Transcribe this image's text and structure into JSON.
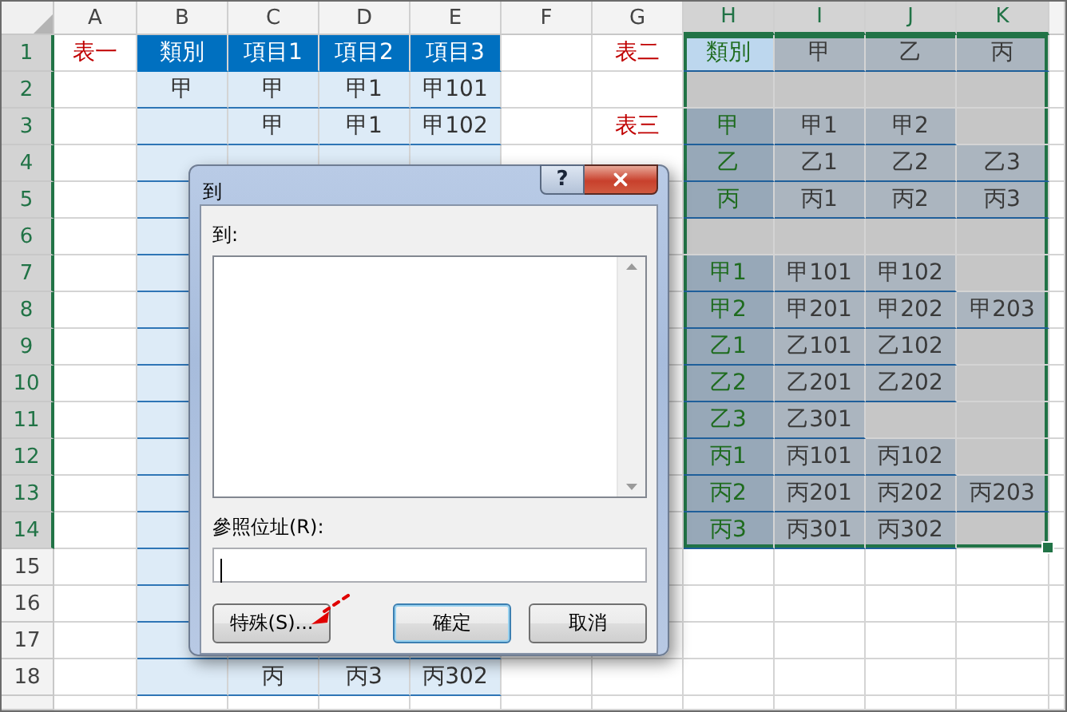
{
  "sheet": {
    "columns": [
      {
        "label": "A",
        "selected": false
      },
      {
        "label": "B",
        "selected": false
      },
      {
        "label": "C",
        "selected": false
      },
      {
        "label": "D",
        "selected": false
      },
      {
        "label": "E",
        "selected": false
      },
      {
        "label": "F",
        "selected": false
      },
      {
        "label": "G",
        "selected": false
      },
      {
        "label": "H",
        "selected": true
      },
      {
        "label": "I",
        "selected": true
      },
      {
        "label": "J",
        "selected": true
      },
      {
        "label": "K",
        "selected": true
      }
    ],
    "rows": [
      {
        "label": "1",
        "selected": true,
        "cells": [
          "表一",
          "類別",
          "項目1",
          "項目2",
          "項目3",
          null,
          "表二",
          "類別",
          "甲",
          "乙",
          "丙"
        ]
      },
      {
        "label": "2",
        "selected": true,
        "cells": [
          null,
          "甲",
          "甲",
          "甲1",
          "甲101",
          null,
          null,
          null,
          null,
          null,
          null
        ]
      },
      {
        "label": "3",
        "selected": true,
        "cells": [
          null,
          null,
          "甲",
          "甲1",
          "甲102",
          null,
          "表三",
          "甲",
          "甲1",
          "甲2",
          null
        ]
      },
      {
        "label": "4",
        "selected": true,
        "cells": [
          null,
          null,
          null,
          null,
          null,
          null,
          null,
          "乙",
          "乙1",
          "乙2",
          "乙3"
        ]
      },
      {
        "label": "5",
        "selected": true,
        "cells": [
          null,
          null,
          null,
          null,
          null,
          null,
          null,
          "丙",
          "丙1",
          "丙2",
          "丙3"
        ]
      },
      {
        "label": "6",
        "selected": true,
        "cells": [
          null,
          null,
          null,
          null,
          null,
          null,
          null,
          null,
          null,
          null,
          null
        ]
      },
      {
        "label": "7",
        "selected": true,
        "cells": [
          null,
          null,
          null,
          null,
          null,
          null,
          null,
          "甲1",
          "甲101",
          "甲102",
          null
        ]
      },
      {
        "label": "8",
        "selected": true,
        "cells": [
          null,
          null,
          null,
          null,
          null,
          null,
          null,
          "甲2",
          "甲201",
          "甲202",
          "甲203"
        ]
      },
      {
        "label": "9",
        "selected": true,
        "cells": [
          null,
          null,
          null,
          null,
          null,
          null,
          null,
          "乙1",
          "乙101",
          "乙102",
          null
        ]
      },
      {
        "label": "10",
        "selected": true,
        "cells": [
          null,
          null,
          null,
          null,
          null,
          null,
          null,
          "乙2",
          "乙201",
          "乙202",
          null
        ]
      },
      {
        "label": "11",
        "selected": true,
        "cells": [
          null,
          null,
          null,
          null,
          null,
          null,
          null,
          "乙3",
          "乙301",
          null,
          null
        ]
      },
      {
        "label": "12",
        "selected": true,
        "cells": [
          null,
          null,
          null,
          null,
          null,
          null,
          null,
          "丙1",
          "丙101",
          "丙102",
          null
        ]
      },
      {
        "label": "13",
        "selected": true,
        "cells": [
          null,
          null,
          null,
          null,
          null,
          null,
          null,
          "丙2",
          "丙201",
          "丙202",
          "丙203"
        ]
      },
      {
        "label": "14",
        "selected": true,
        "cells": [
          null,
          null,
          null,
          null,
          null,
          null,
          null,
          "丙3",
          "丙301",
          "丙302",
          null
        ]
      },
      {
        "label": "15",
        "selected": false,
        "cells": [
          null,
          null,
          null,
          null,
          null,
          null,
          null,
          null,
          null,
          null,
          null
        ]
      },
      {
        "label": "16",
        "selected": false,
        "cells": [
          null,
          null,
          null,
          null,
          null,
          null,
          null,
          null,
          null,
          null,
          null
        ]
      },
      {
        "label": "17",
        "selected": false,
        "cells": [
          null,
          null,
          null,
          null,
          null,
          null,
          null,
          null,
          null,
          null,
          null
        ]
      },
      {
        "label": "18",
        "selected": false,
        "cells": [
          null,
          null,
          "丙",
          "丙3",
          "丙302",
          null,
          null,
          null,
          null,
          null,
          null
        ]
      }
    ]
  },
  "dialog": {
    "title": "到",
    "help_button": "?",
    "goto_label": "到:",
    "reference_label": "參照位址(R):",
    "buttons": [
      {
        "label": "特殊(S)...",
        "kind": "plain"
      },
      {
        "label": "確定",
        "kind": "default"
      },
      {
        "label": "取消",
        "kind": "plain"
      }
    ]
  }
}
